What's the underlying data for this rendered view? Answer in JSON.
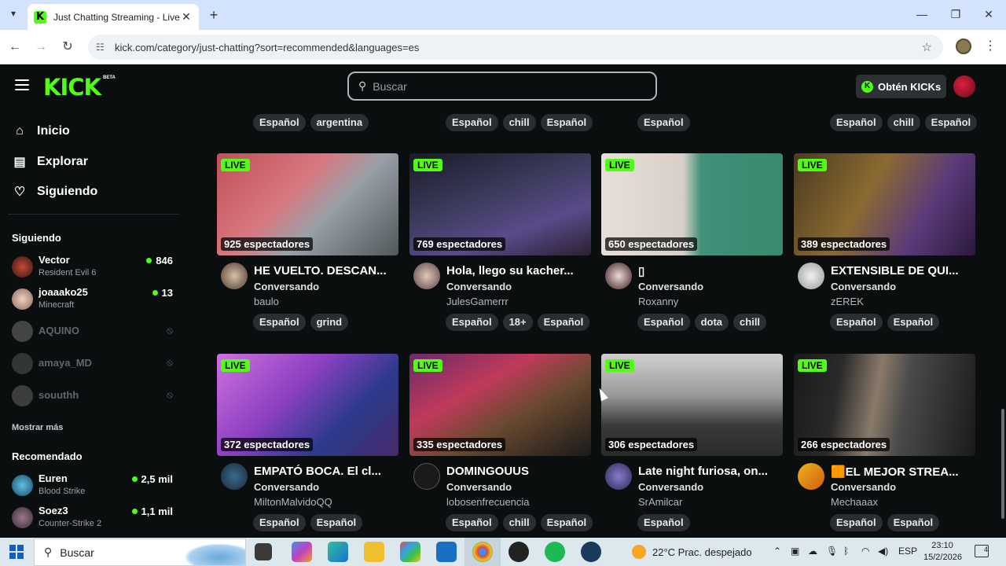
{
  "browser": {
    "tab_title": "Just Chatting Streaming - Live S",
    "url": "kick.com/category/just-chatting?sort=recommended&languages=es",
    "new_tab_symbol": "+",
    "close_symbol": "✕"
  },
  "header": {
    "logo": "KICK",
    "logo_badge": "BETA",
    "search_placeholder": "Buscar",
    "kicks_button": "Obtén KICKs",
    "brand_color": "#53fc18"
  },
  "sidebar": {
    "nav": [
      {
        "label": "Inicio",
        "icon": "home-icon"
      },
      {
        "label": "Explorar",
        "icon": "browse-icon"
      },
      {
        "label": "Siguiendo",
        "icon": "heart-icon"
      }
    ],
    "following_heading": "Siguiendo",
    "following": [
      {
        "name": "Vector",
        "game": "Resident Evil 6",
        "viewers": "846",
        "live": true
      },
      {
        "name": "joaaako25",
        "game": "Minecraft",
        "viewers": "13",
        "live": true
      },
      {
        "name": "AQUINO",
        "live": false
      },
      {
        "name": "amaya_MD",
        "live": false
      },
      {
        "name": "souuthh",
        "live": false
      }
    ],
    "show_more": "Mostrar más",
    "recommended_heading": "Recomendado",
    "recommended": [
      {
        "name": "Euren",
        "game": "Blood Strike",
        "viewers": "2,5 mil"
      },
      {
        "name": "Soez3",
        "game": "Counter-Strike 2",
        "viewers": "1,1 mil"
      }
    ]
  },
  "top_tag_rows": [
    [
      "Español",
      "argentina"
    ],
    [
      "Español",
      "chill",
      "Español"
    ],
    [
      "Español"
    ],
    [
      "Español",
      "chill",
      "Español"
    ]
  ],
  "streams": [
    {
      "live": "LIVE",
      "viewers": "925 espectadores",
      "title": "HE VUELTO. DESCAN...",
      "category": "Conversando",
      "user": "baulo",
      "tags": [
        "Español",
        "grind"
      ]
    },
    {
      "live": "LIVE",
      "viewers": "769 espectadores",
      "title": "Hola, llego su kacher...",
      "category": "Conversando",
      "user": "JulesGamerrr",
      "tags": [
        "Español",
        "18+",
        "Español"
      ]
    },
    {
      "live": "LIVE",
      "viewers": "650 espectadores",
      "title": "▯",
      "category": "Conversando",
      "user": "Roxanny",
      "tags": [
        "Español",
        "dota",
        "chill"
      ]
    },
    {
      "live": "LIVE",
      "viewers": "389 espectadores",
      "title": "EXTENSIBLE DE QUI...",
      "category": "Conversando",
      "user": "zEREK",
      "tags": [
        "Español",
        "Español"
      ]
    },
    {
      "live": "LIVE",
      "viewers": "372 espectadores",
      "title": "EMPATÓ BOCA. El cl...",
      "category": "Conversando",
      "user": "MiltonMalvidoQQ",
      "tags": [
        "Español",
        "Español"
      ]
    },
    {
      "live": "LIVE",
      "viewers": "335 espectadores",
      "title": "DOMINGOUUS",
      "category": "Conversando",
      "user": "lobosenfrecuencia",
      "tags": [
        "Español",
        "chill",
        "Español"
      ]
    },
    {
      "live": "LIVE",
      "viewers": "306 espectadores",
      "title": "Late night furiosa, on...",
      "category": "Conversando",
      "user": "SrAmilcar",
      "tags": [
        "Español"
      ]
    },
    {
      "live": "LIVE",
      "viewers": "266 espectadores",
      "title": "🟧EL MEJOR STREA...",
      "category": "Conversando",
      "user": "Mechaaax",
      "tags": [
        "Español",
        "Español"
      ]
    }
  ],
  "taskbar": {
    "search": "Buscar",
    "weather": "22°C  Prac. despejado",
    "lang": "ESP",
    "time": "23:10",
    "date": "15/2/2026",
    "notifications": "4"
  }
}
